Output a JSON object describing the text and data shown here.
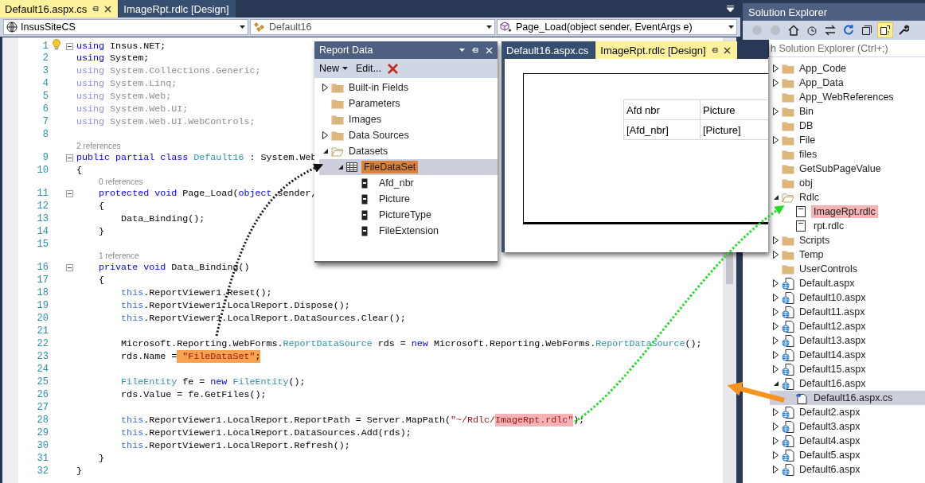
{
  "editor_tabs": [
    {
      "label": "Default16.aspx.cs",
      "selected": true
    },
    {
      "label": "ImageRpt.rdlc [Design]",
      "selected": false
    }
  ],
  "navigation_bar": [
    {
      "kind": "project",
      "text": "InsusSiteCS"
    },
    {
      "kind": "class",
      "text": "Default16"
    },
    {
      "kind": "member",
      "text": "Page_Load(object sender, EventArgs e)"
    }
  ],
  "code_lines": [
    {
      "number": "1",
      "fold": true,
      "lightbulb": true,
      "tokens": [
        {
          "kind": "keyword",
          "text": "using"
        },
        {
          "kind": "plain",
          "text": " Insus.NET;"
        }
      ]
    },
    {
      "number": "2",
      "fold": false,
      "tokens": [
        {
          "kind": "keyword",
          "text": "using"
        },
        {
          "kind": "plain",
          "text": " System;"
        }
      ]
    },
    {
      "number": "3",
      "fold": false,
      "tokens": [
        {
          "kind": "keyword_dim",
          "text": "using"
        },
        {
          "kind": "plain_dim",
          "text": " System.Collections.Generic;"
        }
      ]
    },
    {
      "number": "4",
      "fold": false,
      "tokens": [
        {
          "kind": "keyword_dim",
          "text": "using"
        },
        {
          "kind": "plain_dim",
          "text": " System.Linq;"
        }
      ]
    },
    {
      "number": "5",
      "fold": false,
      "tokens": [
        {
          "kind": "keyword_dim",
          "text": "using"
        },
        {
          "kind": "plain_dim",
          "text": " System.Web;"
        }
      ]
    },
    {
      "number": "6",
      "fold": false,
      "tokens": [
        {
          "kind": "keyword_dim",
          "text": "using"
        },
        {
          "kind": "plain_dim",
          "text": " System.Web.UI;"
        }
      ]
    },
    {
      "number": "7",
      "fold": false,
      "tokens": [
        {
          "kind": "keyword_dim",
          "text": "using"
        },
        {
          "kind": "plain_dim",
          "text": " System.Web.UI.WebControls;"
        }
      ]
    },
    {
      "number": "8",
      "fold": false
    },
    {
      "number": "9",
      "fold": true,
      "references": "2 references",
      "tokens": [
        {
          "kind": "keyword",
          "text": "public"
        },
        {
          "kind": "keyword",
          "text": " partial"
        },
        {
          "kind": "keyword",
          "text": " class"
        },
        {
          "kind": "type",
          "text": " Default16"
        },
        {
          "kind": "plain",
          "text": " : System.Web"
        }
      ]
    },
    {
      "number": "10",
      "fold": false,
      "tokens": [
        {
          "kind": "plain",
          "text": "{"
        }
      ]
    },
    {
      "number": "11",
      "fold": true,
      "references": "0 references",
      "tokens": [
        {
          "kind": "keyword",
          "text": "    protected"
        },
        {
          "kind": "keyword",
          "text": " void"
        },
        {
          "kind": "plain",
          "text": " Page_Load("
        },
        {
          "kind": "keyword",
          "text": "object"
        },
        {
          "kind": "plain",
          "text": " sender,"
        }
      ]
    },
    {
      "number": "12",
      "fold": false,
      "tokens": [
        {
          "kind": "plain",
          "text": "    {"
        }
      ]
    },
    {
      "number": "13",
      "fold": false,
      "tokens": [
        {
          "kind": "plain",
          "text": "        Data_Binding();"
        }
      ]
    },
    {
      "number": "14",
      "fold": false,
      "tokens": [
        {
          "kind": "plain",
          "text": "    }"
        }
      ]
    },
    {
      "number": "15",
      "fold": false
    },
    {
      "number": "16",
      "fold": true,
      "references": "1 reference",
      "tokens": [
        {
          "kind": "keyword",
          "text": "    private"
        },
        {
          "kind": "keyword",
          "text": " void"
        },
        {
          "kind": "plain",
          "text": " Data_Binding()"
        }
      ]
    },
    {
      "number": "17",
      "fold": false,
      "tokens": [
        {
          "kind": "plain",
          "text": "    {"
        }
      ]
    },
    {
      "number": "18",
      "fold": false,
      "tokens": [
        {
          "kind": "keyword_this",
          "text": "        this"
        },
        {
          "kind": "plain",
          "text": ".ReportViewer1.Reset();"
        }
      ]
    },
    {
      "number": "19",
      "fold": false,
      "tokens": [
        {
          "kind": "keyword_this",
          "text": "        this"
        },
        {
          "kind": "plain",
          "text": ".ReportViewer1.LocalReport.Dispose();"
        }
      ]
    },
    {
      "number": "20",
      "fold": false,
      "tokens": [
        {
          "kind": "keyword_this",
          "text": "        this"
        },
        {
          "kind": "plain",
          "text": ".ReportViewer1.LocalReport.DataSources.Clear();"
        }
      ]
    },
    {
      "number": "21",
      "fold": false
    },
    {
      "number": "22",
      "fold": false,
      "tokens": [
        {
          "kind": "plain",
          "text": "        Microsoft.Reporting.WebForms."
        },
        {
          "kind": "type",
          "text": "ReportDataSource"
        },
        {
          "kind": "plain",
          "text": " rds = "
        },
        {
          "kind": "keyword",
          "text": "new"
        },
        {
          "kind": "plain",
          "text": " Microsoft.Reporting.WebForms."
        },
        {
          "kind": "type",
          "text": "ReportDataSource"
        },
        {
          "kind": "plain",
          "text": "();"
        }
      ]
    },
    {
      "number": "23",
      "fold": false,
      "tokens": [
        {
          "kind": "plain",
          "text": "        rds.Name ="
        },
        {
          "kind": "string",
          "text": " \"FileDataSet\"",
          "color": "#f7a350"
        },
        {
          "kind": "plain",
          "text": ";",
          "color": "#f7a350"
        }
      ]
    },
    {
      "number": "24",
      "fold": false
    },
    {
      "number": "25",
      "fold": false,
      "tokens": [
        {
          "kind": "type",
          "text": "        FileEntity"
        },
        {
          "kind": "plain",
          "text": " fe = "
        },
        {
          "kind": "keyword",
          "text": "new"
        },
        {
          "kind": "type",
          "text": " FileEntity"
        },
        {
          "kind": "plain",
          "text": "();"
        }
      ]
    },
    {
      "number": "26",
      "fold": false,
      "tokens": [
        {
          "kind": "plain",
          "text": "        rds.Value = fe.GetFiles();"
        }
      ]
    },
    {
      "number": "27",
      "fold": false
    },
    {
      "number": "28",
      "fold": false,
      "tokens": [
        {
          "kind": "keyword_this",
          "text": "        this"
        },
        {
          "kind": "plain",
          "text": ".ReportViewer1.LocalReport.ReportPath = Server.MapPath("
        },
        {
          "kind": "string",
          "text": "\"~/Rdlc/"
        },
        {
          "kind": "string",
          "text": "ImageRpt.rdlc\"",
          "color": "#f4b3b6"
        },
        {
          "kind": "plain",
          "text": ");"
        }
      ]
    },
    {
      "number": "29",
      "fold": false,
      "tokens": [
        {
          "kind": "keyword_this",
          "text": "        this"
        },
        {
          "kind": "plain",
          "text": ".ReportViewer1.LocalReport.DataSources.Add(rds);"
        }
      ]
    },
    {
      "number": "30",
      "fold": false,
      "tokens": [
        {
          "kind": "keyword_this",
          "text": "        this"
        },
        {
          "kind": "plain",
          "text": ".ReportViewer1.LocalReport.Refresh();"
        }
      ]
    },
    {
      "number": "31",
      "fold": false,
      "tokens": [
        {
          "kind": "plain",
          "text": "    }"
        }
      ]
    },
    {
      "number": "32",
      "fold": false,
      "tokens": [
        {
          "kind": "plain",
          "text": "}"
        }
      ]
    }
  ],
  "report_data": {
    "title": "Report Data",
    "toolbar": [
      {
        "kind": "dropdown",
        "label": "New"
      },
      {
        "kind": "button",
        "label": "Edit..."
      },
      {
        "kind": "delete"
      }
    ],
    "tree": [
      {
        "kind": "folder",
        "label": "Built-in Fields",
        "expandable": true,
        "expanded": false,
        "selected": false
      },
      {
        "kind": "folder",
        "label": "Parameters",
        "expandable": false,
        "selected": false
      },
      {
        "kind": "folder",
        "label": "Images",
        "expandable": false,
        "selected": false
      },
      {
        "kind": "folder",
        "label": "Data Sources",
        "expandable": true,
        "expanded": false,
        "selected": false
      },
      {
        "kind": "folder",
        "label": "Datasets",
        "expandable": true,
        "expanded": true,
        "selected": false,
        "children": [
          {
            "kind": "dataset",
            "label": "FileDataSet",
            "expandable": true,
            "expanded": true,
            "selected": true,
            "color": "#d9823b",
            "children": [
              {
                "kind": "field",
                "label": "Afd_nbr",
                "expandable": false,
                "selected": false
              },
              {
                "kind": "field",
                "label": "Picture",
                "expandable": false,
                "selected": false
              },
              {
                "kind": "field",
                "label": "PictureType",
                "expandable": false,
                "selected": false
              },
              {
                "kind": "field",
                "label": "FileExtension",
                "expandable": false,
                "selected": false
              }
            ]
          }
        ]
      }
    ]
  },
  "report_designer": {
    "tabs": [
      {
        "label": "Default16.aspx.cs",
        "selected": false
      },
      {
        "label": "ImageRpt.rdlc [Design]",
        "selected": true
      }
    ],
    "table": {
      "header": [
        "Afd nbr",
        "Picture"
      ],
      "row": [
        "[Afd_nbr]",
        "[Picture]"
      ]
    }
  },
  "solution_explorer": {
    "title": "Solution Explorer",
    "search": {
      "placeholder": "h Solution Explorer (Ctrl+;)"
    },
    "tree": [
      {
        "kind": "folder",
        "label": "App_Code",
        "expandable": true,
        "expanded": false,
        "selected": false
      },
      {
        "kind": "folder",
        "label": "App_Data",
        "expandable": true,
        "expanded": false,
        "selected": false
      },
      {
        "kind": "folder",
        "label": "App_WebReferences",
        "expandable": false,
        "selected": false
      },
      {
        "kind": "folder",
        "label": "Bin",
        "expandable": true,
        "expanded": false,
        "selected": false
      },
      {
        "kind": "folder",
        "label": "DB",
        "expandable": false,
        "selected": false
      },
      {
        "kind": "folder",
        "label": "File",
        "expandable": true,
        "expanded": false,
        "selected": false
      },
      {
        "kind": "folder",
        "label": "files",
        "expandable": false,
        "selected": false
      },
      {
        "kind": "folder",
        "label": "GetSubPageValue",
        "expandable": false,
        "selected": false
      },
      {
        "kind": "folder",
        "label": "obj",
        "expandable": false,
        "selected": false
      },
      {
        "kind": "folder",
        "label": "Rdlc",
        "expandable": true,
        "expanded": true,
        "selected": false,
        "children": [
          {
            "kind": "report",
            "label": "ImageRpt.rdlc",
            "expandable": false,
            "selected": false,
            "color": "#f4b3b6"
          },
          {
            "kind": "report",
            "label": "rpt.rdlc",
            "expandable": false,
            "selected": false
          }
        ]
      },
      {
        "kind": "folder",
        "label": "Scripts",
        "expandable": true,
        "expanded": false,
        "selected": false
      },
      {
        "kind": "folder",
        "label": "Temp",
        "expandable": true,
        "expanded": false,
        "selected": false
      },
      {
        "kind": "folder",
        "label": "UserControls",
        "expandable": false,
        "selected": false
      },
      {
        "kind": "page",
        "label": "Default.aspx",
        "expandable": true,
        "expanded": false,
        "selected": false
      },
      {
        "kind": "page",
        "label": "Default10.aspx",
        "expandable": true,
        "expanded": false,
        "selected": false
      },
      {
        "kind": "page",
        "label": "Default11.aspx",
        "expandable": true,
        "expanded": false,
        "selected": false
      },
      {
        "kind": "page",
        "label": "Default12.aspx",
        "expandable": true,
        "expanded": false,
        "selected": false
      },
      {
        "kind": "page",
        "label": "Default13.aspx",
        "expandable": true,
        "expanded": false,
        "selected": false
      },
      {
        "kind": "page",
        "label": "Default14.aspx",
        "expandable": true,
        "expanded": false,
        "selected": false
      },
      {
        "kind": "page",
        "label": "Default15.aspx",
        "expandable": true,
        "expanded": false,
        "selected": false
      },
      {
        "kind": "page",
        "label": "Default16.aspx",
        "expandable": true,
        "expanded": true,
        "selected": false,
        "children": [
          {
            "kind": "code",
            "label": "Default16.aspx.cs",
            "expandable": false,
            "selected": true
          }
        ]
      },
      {
        "kind": "page",
        "label": "Default2.aspx",
        "expandable": true,
        "expanded": false,
        "selected": false
      },
      {
        "kind": "page",
        "label": "Default3.aspx",
        "expandable": true,
        "expanded": false,
        "selected": false
      },
      {
        "kind": "page",
        "label": "Default4.aspx",
        "expandable": true,
        "expanded": false,
        "selected": false
      },
      {
        "kind": "page",
        "label": "Default5.aspx",
        "expandable": true,
        "expanded": false,
        "selected": false
      },
      {
        "kind": "page",
        "label": "Default6.aspx",
        "expandable": true,
        "expanded": false,
        "selected": false
      }
    ]
  }
}
